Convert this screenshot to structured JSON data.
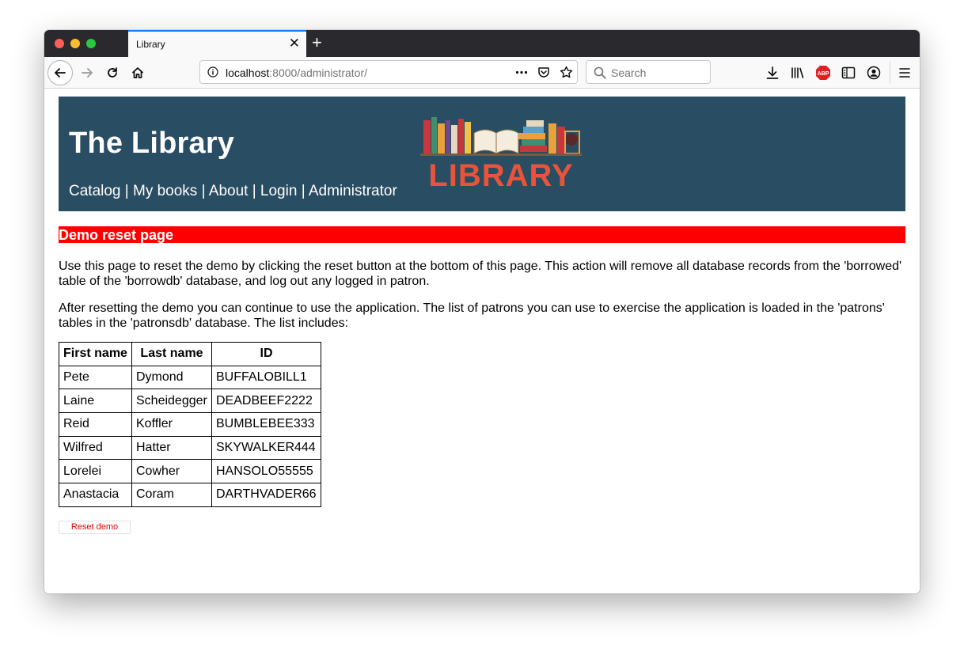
{
  "browser": {
    "tab_title": "Library",
    "tab_close": "✕",
    "new_tab": "+",
    "url_host": "localhost",
    "url_rest": ":8000/administrator/",
    "search_placeholder": "Search"
  },
  "header": {
    "site_title": "The Library",
    "nav": [
      "Catalog",
      "My books",
      "About",
      "Login",
      "Administrator"
    ],
    "nav_separator": " | ",
    "logo_text": "LIBRARY",
    "background": "#294d63"
  },
  "banner": {
    "title": "Demo reset page",
    "color": "#ff0000"
  },
  "paragraphs": [
    "Use this page to reset the demo by clicking the reset button at the bottom of this page. This action will remove all database records from the 'borrowed' table of the 'borrowdb' database, and log out any logged in patron.",
    "After resetting the demo you can continue to use the application. The list of patrons you can use to exercise the application is loaded in the 'patrons' tables in the 'patronsdb' database. The list includes:"
  ],
  "table": {
    "headers": [
      "First name",
      "Last name",
      "ID"
    ],
    "rows": [
      [
        "Pete",
        "Dymond",
        "BUFFALOBILL1"
      ],
      [
        "Laine",
        "Scheidegger",
        "DEADBEEF2222"
      ],
      [
        "Reid",
        "Koffler",
        "BUMBLEBEE333"
      ],
      [
        "Wilfred",
        "Hatter",
        "SKYWALKER444"
      ],
      [
        "Lorelei",
        "Cowher",
        "HANSOLO55555"
      ],
      [
        "Anastacia",
        "Coram",
        "DARTHVADER66"
      ]
    ]
  },
  "reset_button": "Reset demo",
  "icons": {
    "back": "back-arrow-icon",
    "forward": "forward-arrow-icon",
    "reload": "reload-icon",
    "home": "home-icon",
    "info": "info-icon",
    "more": "more-dots-icon",
    "pocket": "pocket-icon",
    "bookmark": "star-icon",
    "search": "search-icon",
    "download": "download-icon",
    "library": "library-icon",
    "adblock": "adblock-icon",
    "sidebar": "sidebar-icon",
    "account": "account-icon",
    "menu": "hamburger-menu-icon"
  },
  "adblock_label": "ABP"
}
